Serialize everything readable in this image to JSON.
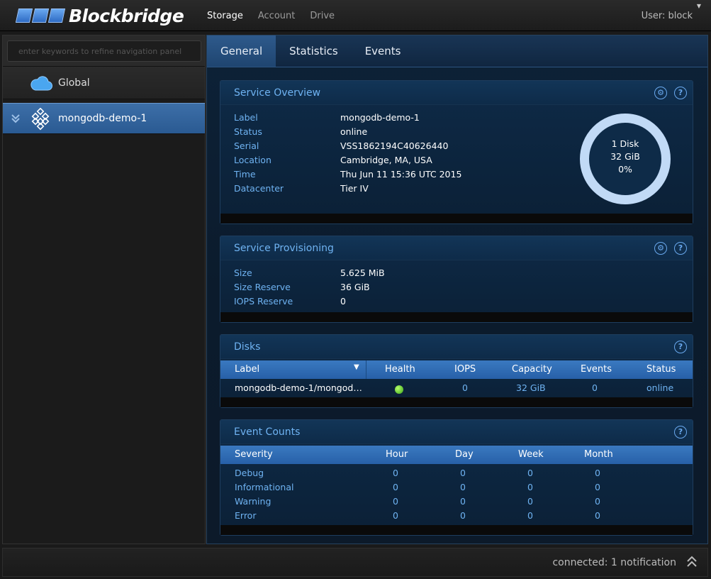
{
  "app": {
    "brand": "Blockbridge",
    "user_label": "User: block"
  },
  "topnav": [
    "Storage",
    "Account",
    "Drive"
  ],
  "sidebar": {
    "search_placeholder": "enter keywords to refine navigation panel",
    "items": [
      {
        "label": "Global",
        "icon": "cloud-icon"
      },
      {
        "label": "mongodb-demo-1",
        "icon": "service-icon"
      }
    ]
  },
  "tabs": [
    "General",
    "Statistics",
    "Events"
  ],
  "overview": {
    "title": "Service Overview",
    "rows": [
      {
        "k": "Label",
        "v": "mongodb-demo-1"
      },
      {
        "k": "Status",
        "v": "online"
      },
      {
        "k": "Serial",
        "v": "VSS1862194C40626440"
      },
      {
        "k": "Location",
        "v": "Cambridge, MA, USA"
      },
      {
        "k": "Time",
        "v": "Thu Jun 11 15:36 UTC 2015"
      },
      {
        "k": "Datacenter",
        "v": "Tier IV"
      }
    ],
    "donut": {
      "line1": "1 Disk",
      "line2": "32 GiB",
      "line3": "0%"
    }
  },
  "provisioning": {
    "title": "Service Provisioning",
    "rows": [
      {
        "k": "Size",
        "v": "5.625 MiB"
      },
      {
        "k": "Size Reserve",
        "v": "36 GiB"
      },
      {
        "k": "IOPS Reserve",
        "v": "0"
      }
    ]
  },
  "disks": {
    "title": "Disks",
    "headers": [
      "Label",
      "Health",
      "IOPS",
      "Capacity",
      "Events",
      "Status"
    ],
    "rows": [
      {
        "label": "mongodb-demo-1/mongod…",
        "health": "green",
        "iops": "0",
        "capacity": "32 GiB",
        "events": "0",
        "status": "online"
      }
    ]
  },
  "event_counts": {
    "title": "Event Counts",
    "headers": [
      "Severity",
      "Hour",
      "Day",
      "Week",
      "Month"
    ],
    "rows": [
      {
        "severity": "Debug",
        "hour": "0",
        "day": "0",
        "week": "0",
        "month": "0"
      },
      {
        "severity": "Informational",
        "hour": "0",
        "day": "0",
        "week": "0",
        "month": "0"
      },
      {
        "severity": "Warning",
        "hour": "0",
        "day": "0",
        "week": "0",
        "month": "0"
      },
      {
        "severity": "Error",
        "hour": "0",
        "day": "0",
        "week": "0",
        "month": "0"
      }
    ]
  },
  "statusbar": {
    "message": "connected: 1 notification"
  }
}
